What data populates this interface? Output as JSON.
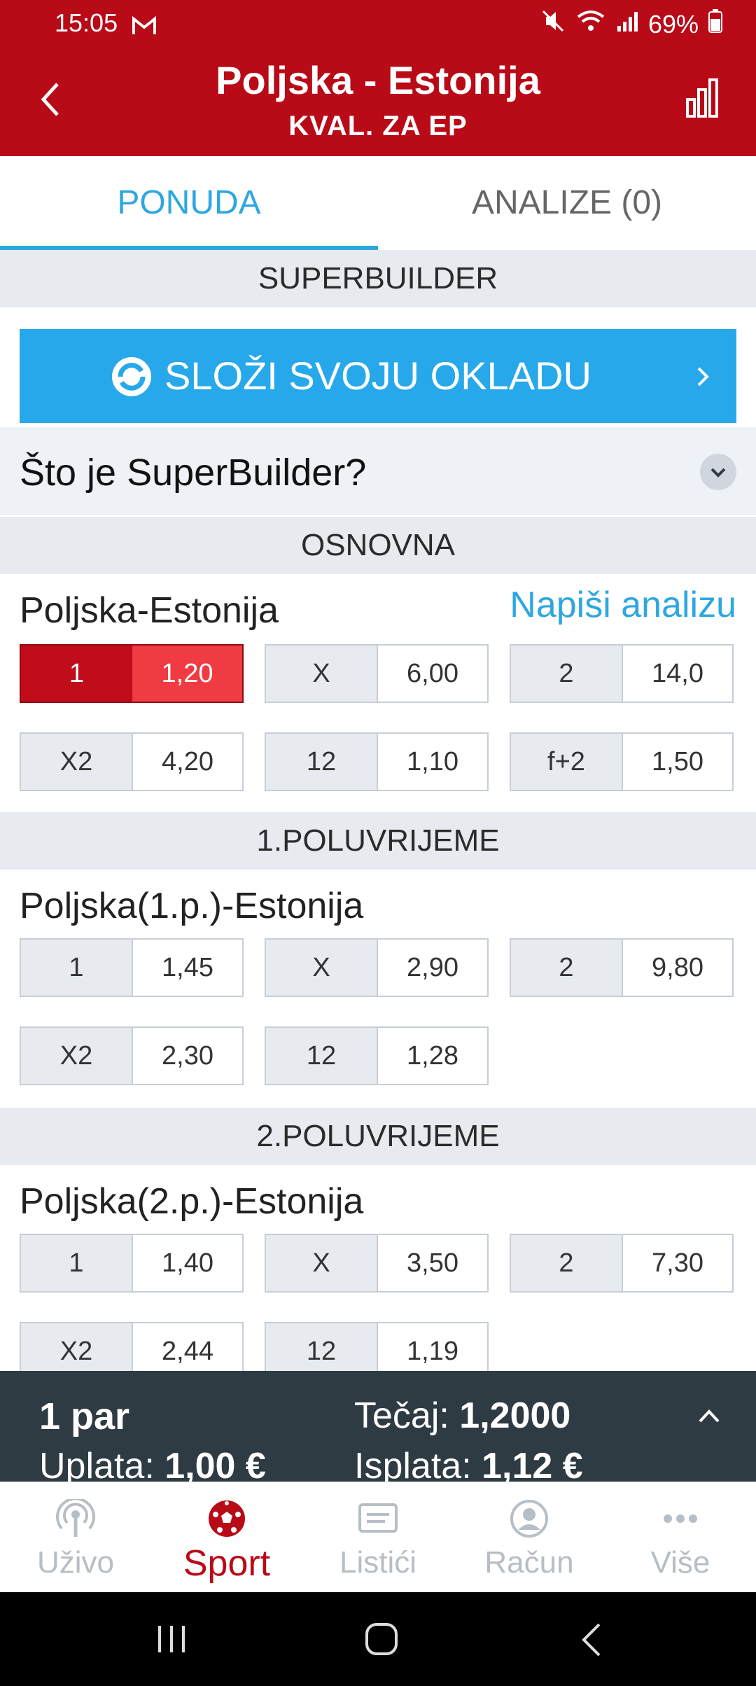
{
  "status": {
    "time": "15:05",
    "battery": "69%"
  },
  "header": {
    "title": "Poljska - Estonija",
    "subtitle": "KVAL. ZA EP"
  },
  "tabs": [
    {
      "label": "PONUDA"
    },
    {
      "label": "ANALIZE (0)"
    }
  ],
  "superbuilder": {
    "section": "SUPERBUILDER",
    "button": "SLOŽI SVOJU OKLADU",
    "faq": "Što je SuperBuilder?"
  },
  "sections": [
    {
      "title": "OSNOVNA",
      "market": "Poljska-Estonija",
      "link": "Napiši analizu",
      "rows": [
        [
          {
            "k": "1",
            "v": "1,20",
            "selected": true
          },
          {
            "k": "X",
            "v": "6,00"
          },
          {
            "k": "2",
            "v": "14,0"
          }
        ],
        [
          {
            "k": "X2",
            "v": "4,20"
          },
          {
            "k": "12",
            "v": "1,10"
          },
          {
            "k": "f+2",
            "v": "1,50"
          }
        ]
      ]
    },
    {
      "title": "1.POLUVRIJEME",
      "market": "Poljska(1.p.)-Estonija",
      "rows": [
        [
          {
            "k": "1",
            "v": "1,45"
          },
          {
            "k": "X",
            "v": "2,90"
          },
          {
            "k": "2",
            "v": "9,80"
          }
        ],
        [
          {
            "k": "X2",
            "v": "2,30"
          },
          {
            "k": "12",
            "v": "1,28"
          }
        ]
      ]
    },
    {
      "title": "2.POLUVRIJEME",
      "market": "Poljska(2.p.)-Estonija",
      "rows": [
        [
          {
            "k": "1",
            "v": "1,40"
          },
          {
            "k": "X",
            "v": "3,50"
          },
          {
            "k": "2",
            "v": "7,30"
          }
        ],
        [
          {
            "k": "X2",
            "v": "2,44"
          },
          {
            "k": "12",
            "v": "1,19"
          }
        ]
      ]
    }
  ],
  "betslip": {
    "pairs": "1 par",
    "rate_label": "Tečaj:",
    "rate_value": "1,2000",
    "stake_label": "Uplata:",
    "stake_value": "1,00 €",
    "payout_label": "Isplata:",
    "payout_value": "1,12 €"
  },
  "nav": [
    {
      "label": "Uživo",
      "icon": "live-icon"
    },
    {
      "label": "Sport",
      "icon": "soccer-ball-icon",
      "active": true
    },
    {
      "label": "Listići",
      "icon": "ticket-icon"
    },
    {
      "label": "Račun",
      "icon": "user-icon"
    },
    {
      "label": "Više",
      "icon": "more-icon"
    }
  ],
  "colors": {
    "brand": "#b90a17",
    "accent": "#27a8ea",
    "selected": "#f03b43"
  }
}
